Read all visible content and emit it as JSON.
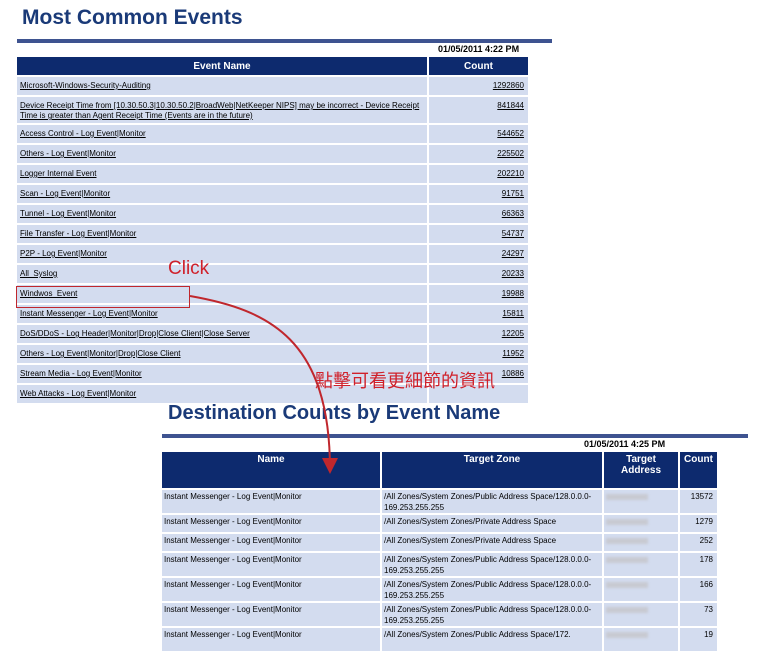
{
  "report1": {
    "title": "Most Common Events",
    "timestamp": "01/05/2011  4:22 PM",
    "columns": [
      "Event Name",
      "Count"
    ],
    "rows": [
      {
        "name": "Microsoft-Windows-Security-Auditing",
        "count": "1292860"
      },
      {
        "name": "Device Receipt Time from [10.30.50.3|10.30.50.2|BroadWeb|NetKeeper NIPS] may be incorrect - Device Receipt Time is greater than Agent Receipt Time (Events are in the future)",
        "count": "841844"
      },
      {
        "name": "Access Control - Log Event|Monitor",
        "count": "544652"
      },
      {
        "name": "Others - Log Event|Monitor",
        "count": "225502"
      },
      {
        "name": "Logger Internal Event",
        "count": "202210"
      },
      {
        "name": "Scan - Log Event|Monitor",
        "count": "91751"
      },
      {
        "name": "Tunnel - Log Event|Monitor",
        "count": "66363"
      },
      {
        "name": "File Transfer - Log Event|Monitor",
        "count": "54737"
      },
      {
        "name": "P2P - Log Event|Monitor",
        "count": "24297"
      },
      {
        "name": "All_Syslog",
        "count": "20233"
      },
      {
        "name": "Windwos_Event",
        "count": "19988"
      },
      {
        "name": "Instant Messenger - Log Event|Monitor",
        "count": "15811"
      },
      {
        "name": "DoS/DDoS - Log Header|Monitor|Drop|Close Client|Close Server",
        "count": "12205"
      },
      {
        "name": "Others - Log Event|Monitor|Drop|Close Client",
        "count": "11952"
      },
      {
        "name": "Stream Media - Log Event|Monitor",
        "count": "10886"
      },
      {
        "name": "Web Attacks - Log Event|Monitor",
        "count": ""
      }
    ]
  },
  "report2": {
    "title": "Destination Counts by Event Name",
    "timestamp": "01/05/2011  4:25 PM",
    "columns": [
      "Name",
      "Target Zone",
      "Target Address",
      "Count"
    ],
    "rows": [
      {
        "name": "Instant Messenger - Log Event|Monitor",
        "zone": "/All Zones/System Zones/Public Address Space/128.0.0.0-169.253.255.255",
        "count": "13572"
      },
      {
        "name": "Instant Messenger - Log Event|Monitor",
        "zone": "/All Zones/System Zones/Private Address Space",
        "count": "1279"
      },
      {
        "name": "Instant Messenger - Log Event|Monitor",
        "zone": "/All Zones/System Zones/Private Address Space",
        "count": "252"
      },
      {
        "name": "Instant Messenger - Log Event|Monitor",
        "zone": "/All Zones/System Zones/Public Address Space/128.0.0.0-169.253.255.255",
        "count": "178"
      },
      {
        "name": "Instant Messenger - Log Event|Monitor",
        "zone": "/All Zones/System Zones/Public Address Space/128.0.0.0-169.253.255.255",
        "count": "166"
      },
      {
        "name": "Instant Messenger - Log Event|Monitor",
        "zone": "/All Zones/System Zones/Public Address Space/128.0.0.0-169.253.255.255",
        "count": "73"
      },
      {
        "name": "Instant Messenger - Log Event|Monitor",
        "zone": "/All Zones/System Zones/Public Address Space/172.",
        "count": "19"
      }
    ]
  },
  "annotations": {
    "click_label": "Click",
    "note": "點擊可看更細節的資訊",
    "color": "#d0202a"
  }
}
